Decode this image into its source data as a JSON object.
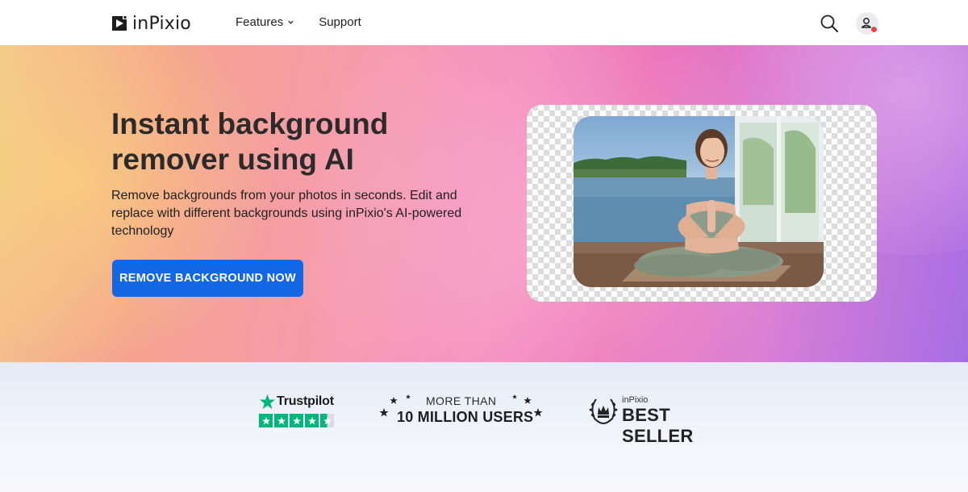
{
  "header": {
    "brand": "inPixio",
    "nav": [
      {
        "label": "Features",
        "has_dropdown": true
      },
      {
        "label": "Support",
        "has_dropdown": false
      }
    ],
    "icons": [
      "search-icon",
      "user-account-icon"
    ]
  },
  "hero": {
    "title": "Instant background remover using AI",
    "subtitle": "Remove backgrounds from your photos in seconds. Edit and replace with different backgrounds using inPixio's AI-powered technology",
    "cta_label": "REMOVE BACKGROUND NOW"
  },
  "trust": {
    "trustpilot": {
      "name": "Trustpilot",
      "rating_stars": 4.5
    },
    "users": {
      "top": "MORE THAN",
      "main": "10 MILLION USERS"
    },
    "seller": {
      "brand": "inPixio",
      "main": "BEST SELLER"
    }
  },
  "colors": {
    "cta": "#1267e4",
    "trustpilot_green": "#00b67a",
    "notification_dot": "#e64545"
  }
}
